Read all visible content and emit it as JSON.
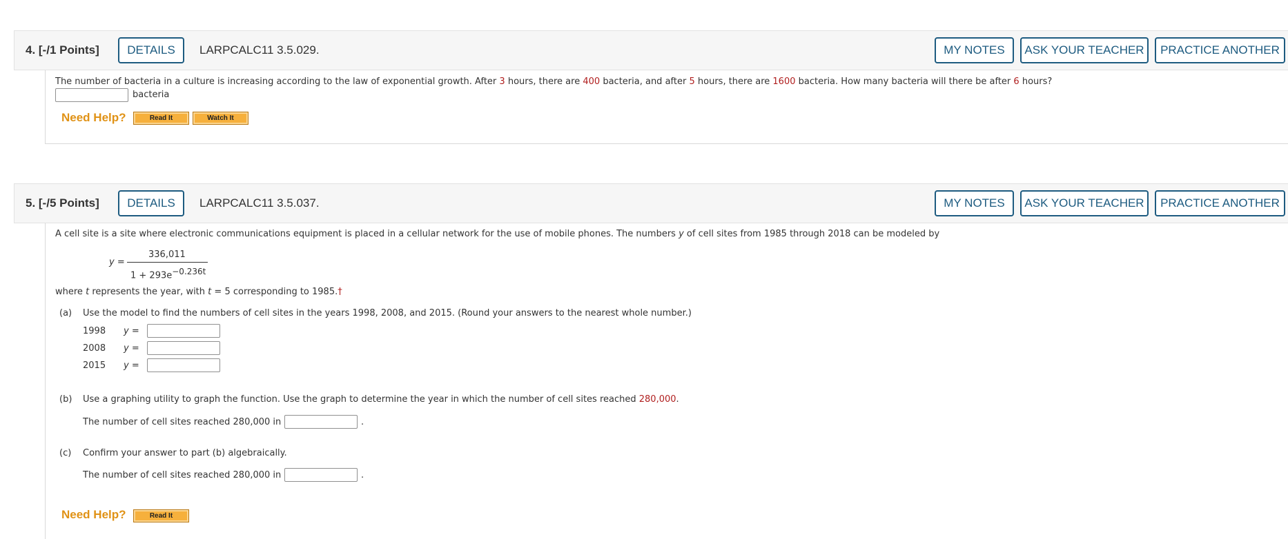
{
  "common": {
    "details_label": "DETAILS",
    "my_notes_label": "MY NOTES",
    "ask_teacher_label": "ASK YOUR TEACHER",
    "practice_label": "PRACTICE ANOTHER",
    "need_help_label": "Need Help?",
    "read_it_label": "Read It",
    "watch_it_label": "Watch It"
  },
  "q4": {
    "number": "4. [-/1 Points]",
    "ref": "LARPCALC11 3.5.029.",
    "text_1": "The number of bacteria in a culture is increasing according to the law of exponential growth. After",
    "hours_1": "3",
    "text_2": "hours, there are",
    "count_1": "400",
    "text_3": "bacteria, and after",
    "hours_2": "5",
    "text_4": "hours, there are",
    "count_2": "1600",
    "text_5": "bacteria. How many bacteria will there be after",
    "hours_3": "6",
    "text_6": "hours?",
    "unit": "bacteria"
  },
  "q5": {
    "number": "5. [-/5 Points]",
    "ref": "LARPCALC11 3.5.037.",
    "intro_1": "A cell site is a site where electronic communications equipment is placed in a cellular network for the use of mobile phones. The numbers",
    "intro_var": "y",
    "intro_2": "of cell sites from 1985 through 2018 can be modeled by",
    "formula_lhs": "y =",
    "formula_num": "336,011",
    "formula_den": "1 + 293e",
    "formula_exp": "−0.236t",
    "where_1": "where",
    "where_var": "t",
    "where_2": "represents the year, with",
    "where_var2": "t",
    "where_3": "= 5 corresponding to 1985.",
    "dagger": "†",
    "a_label": "(a)",
    "a_text": "Use the model to find the numbers of cell sites in the years 1998, 2008, and 2015. (Round your answers to the nearest whole number.)",
    "years": [
      "1998",
      "2008",
      "2015"
    ],
    "y_eq": "y  =",
    "b_label": "(b)",
    "b_text_1": "Use a graphing utility to graph the function. Use the graph to determine the year in which the number of cell sites reached",
    "b_value": "280,000",
    "b_period": ".",
    "b_answer": "The number of cell sites reached 280,000 in",
    "c_label": "(c)",
    "c_text": "Confirm your answer to part (b) algebraically.",
    "c_answer": "The number of cell sites reached 280,000 in",
    "period": "."
  }
}
